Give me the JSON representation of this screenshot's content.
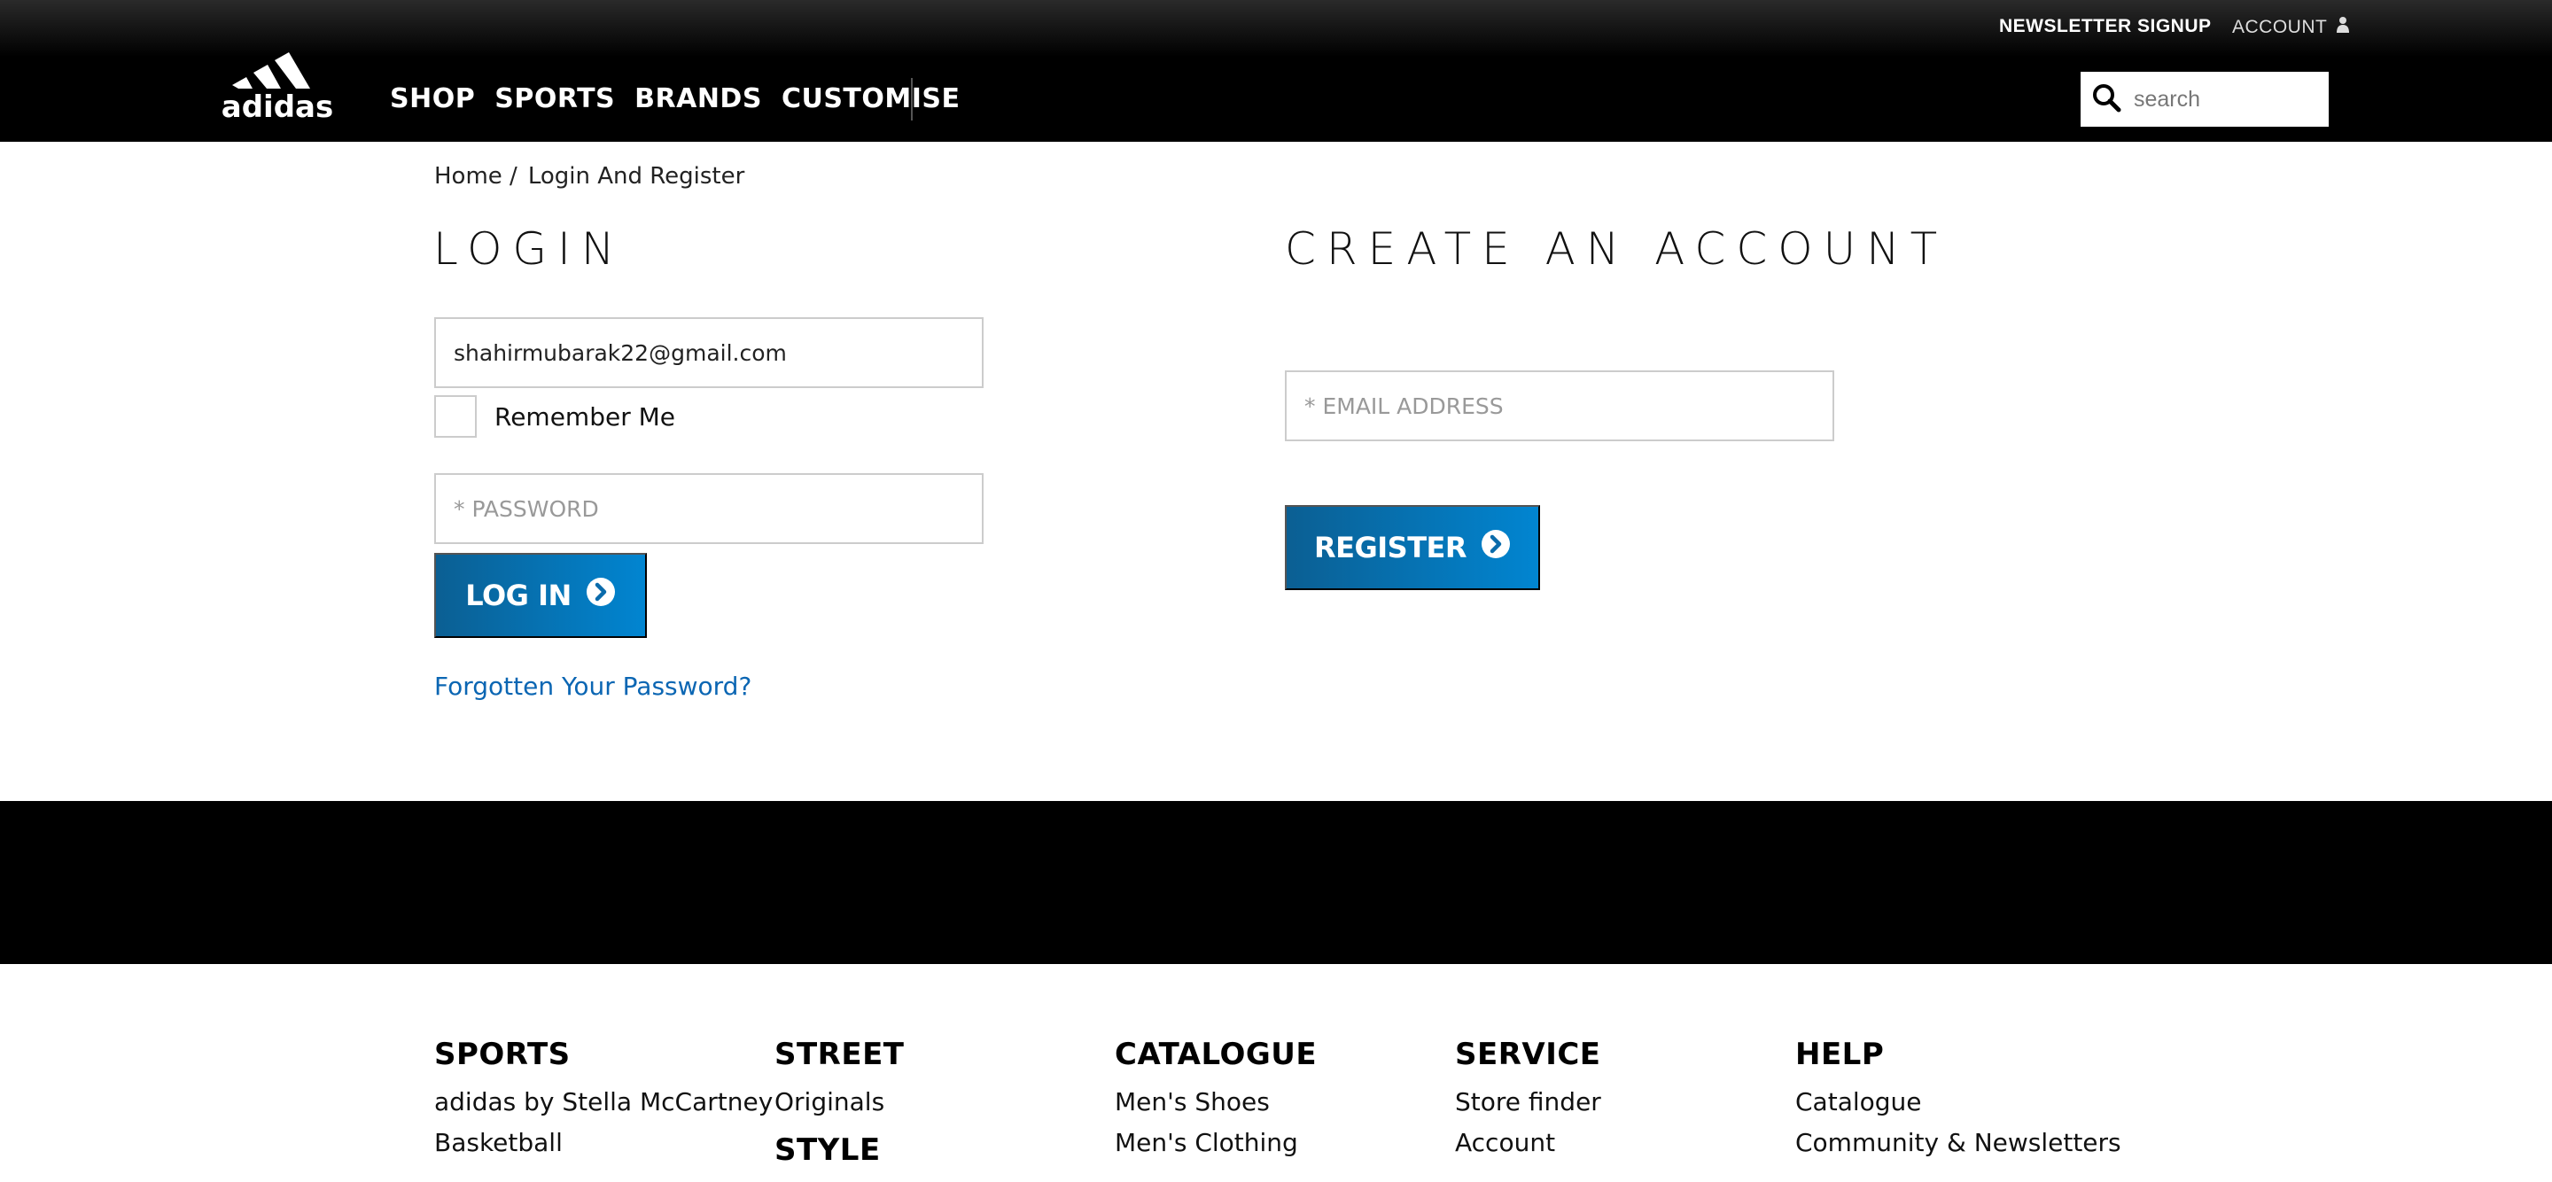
{
  "header": {
    "newsletter_label": "NEWSLETTER SIGNUP",
    "account_label": "ACCOUNT",
    "logo_text": "adidas",
    "nav": [
      "SHOP",
      "SPORTS",
      "BRANDS",
      "CUSTOMISE"
    ],
    "search_placeholder": "search"
  },
  "breadcrumb": {
    "home": "Home /",
    "current": "Login And Register"
  },
  "login": {
    "title": "LOGIN",
    "email_value": "shahirmubarak22@gmail.com",
    "remember_label": "Remember Me",
    "password_placeholder": "* PASSWORD",
    "button_label": "LOG IN",
    "forgot_label": "Forgotten Your Password?"
  },
  "register": {
    "title": "CREATE AN ACCOUNT",
    "email_placeholder": "* EMAIL ADDRESS",
    "button_label": "REGISTER"
  },
  "footer": {
    "sports": {
      "title": "SPORTS",
      "links": [
        "adidas by Stella McCartney",
        "Basketball"
      ]
    },
    "street": {
      "title": "STREET",
      "links": [
        "Originals"
      ],
      "second_title": "STYLE"
    },
    "catalogue": {
      "title": "CATALOGUE",
      "links": [
        "Men's Shoes",
        "Men's Clothing"
      ]
    },
    "service": {
      "title": "SERVICE",
      "links": [
        "Store finder",
        "Account"
      ]
    },
    "help": {
      "title": "HELP",
      "links": [
        "Catalogue",
        "Community & Newsletters"
      ]
    }
  },
  "colors": {
    "accent_blue": "#0185d1",
    "link_blue": "#0b66b3",
    "header_black": "#000000"
  }
}
